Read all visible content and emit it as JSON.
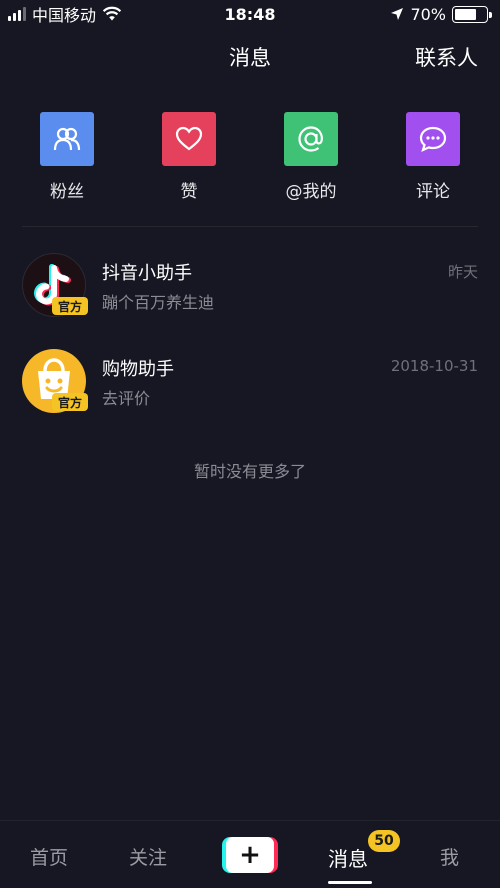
{
  "status_bar": {
    "carrier": "中国移动",
    "time": "18:48",
    "battery_text": "70%",
    "battery_level": 0.7,
    "signal_bars": 3
  },
  "header": {
    "title": "消息",
    "contacts": "联系人"
  },
  "quick_actions": [
    {
      "label": "粉丝",
      "icon": "people-icon",
      "color": "#5b8def"
    },
    {
      "label": "赞",
      "icon": "heart-icon",
      "color": "#e5415c"
    },
    {
      "label": "@我的",
      "icon": "at-icon",
      "color": "#3fc176"
    },
    {
      "label": "评论",
      "icon": "comment-icon",
      "color": "#a24ff0"
    }
  ],
  "messages": [
    {
      "name": "抖音小助手",
      "subtitle": "蹦个百万养生迪",
      "time": "昨天",
      "badge": "官方",
      "avatar": "douyin-logo-icon"
    },
    {
      "name": "购物助手",
      "subtitle": "去评价",
      "time": "2018-10-31",
      "badge": "官方",
      "avatar": "shopping-bag-icon"
    }
  ],
  "empty_hint": "暂时没有更多了",
  "tabbar": {
    "home": "首页",
    "follow": "关注",
    "plus": "+",
    "messages": "消息",
    "messages_count": "50",
    "me": "我"
  },
  "colors": {
    "background": "#161722",
    "badge_yellow": "#f4c324"
  }
}
